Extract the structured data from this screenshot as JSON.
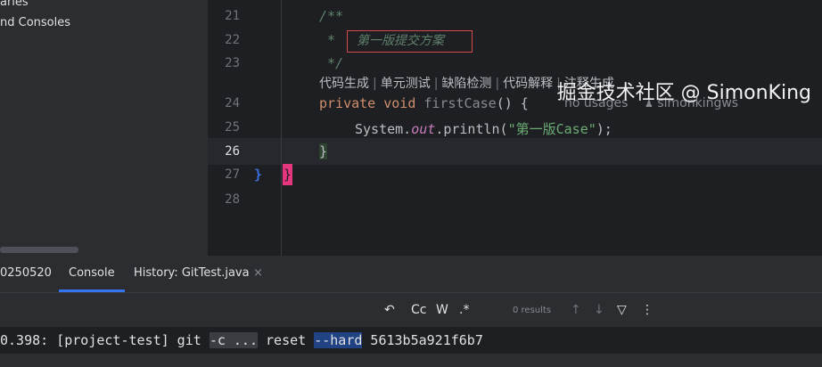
{
  "project_tree": {
    "items": [
      "aries",
      "nd Consoles"
    ]
  },
  "editor": {
    "line_numbers": [
      "21",
      "22",
      "23",
      "24",
      "25",
      "26",
      "27",
      "28"
    ],
    "current_line": "26",
    "lines": {
      "l21": "/**",
      "l22_star": "*",
      "l22_todo": "第一版提交方案",
      "l23": "*/",
      "l24_kw1": "private",
      "l24_kw2": "void",
      "l24_name": "firstCase",
      "l24_rest": "() {",
      "l25_a": "System.",
      "l25_field": "out",
      "l25_b": ".println(",
      "l25_str": "\"第一版Case\"",
      "l25_c": ");",
      "l26": "}",
      "l27_a": "}",
      "l27_b": "}"
    },
    "ai_actions": [
      "代码生成",
      "单元测试",
      "缺陷检测",
      "代码解释",
      "注释生成"
    ],
    "separator": "|",
    "hints": {
      "usages": "no usages",
      "author": "simonkingws"
    }
  },
  "tool_window": {
    "tabs": [
      "0250520",
      "Console",
      "History: GitTest.java"
    ],
    "close_glyph": "×",
    "toolbar": {
      "regex_tools": [
        "Cc",
        "W",
        ".*"
      ],
      "results": "0 results"
    },
    "console": {
      "prefix": "0.398: [project-test] git ",
      "opt_c": "-c ...",
      "cmd": " reset ",
      "opt_hard": "--hard",
      "hash": " 5613b5a921f6b7"
    }
  },
  "watermark": "掘金技术社区 @ SimonKing"
}
